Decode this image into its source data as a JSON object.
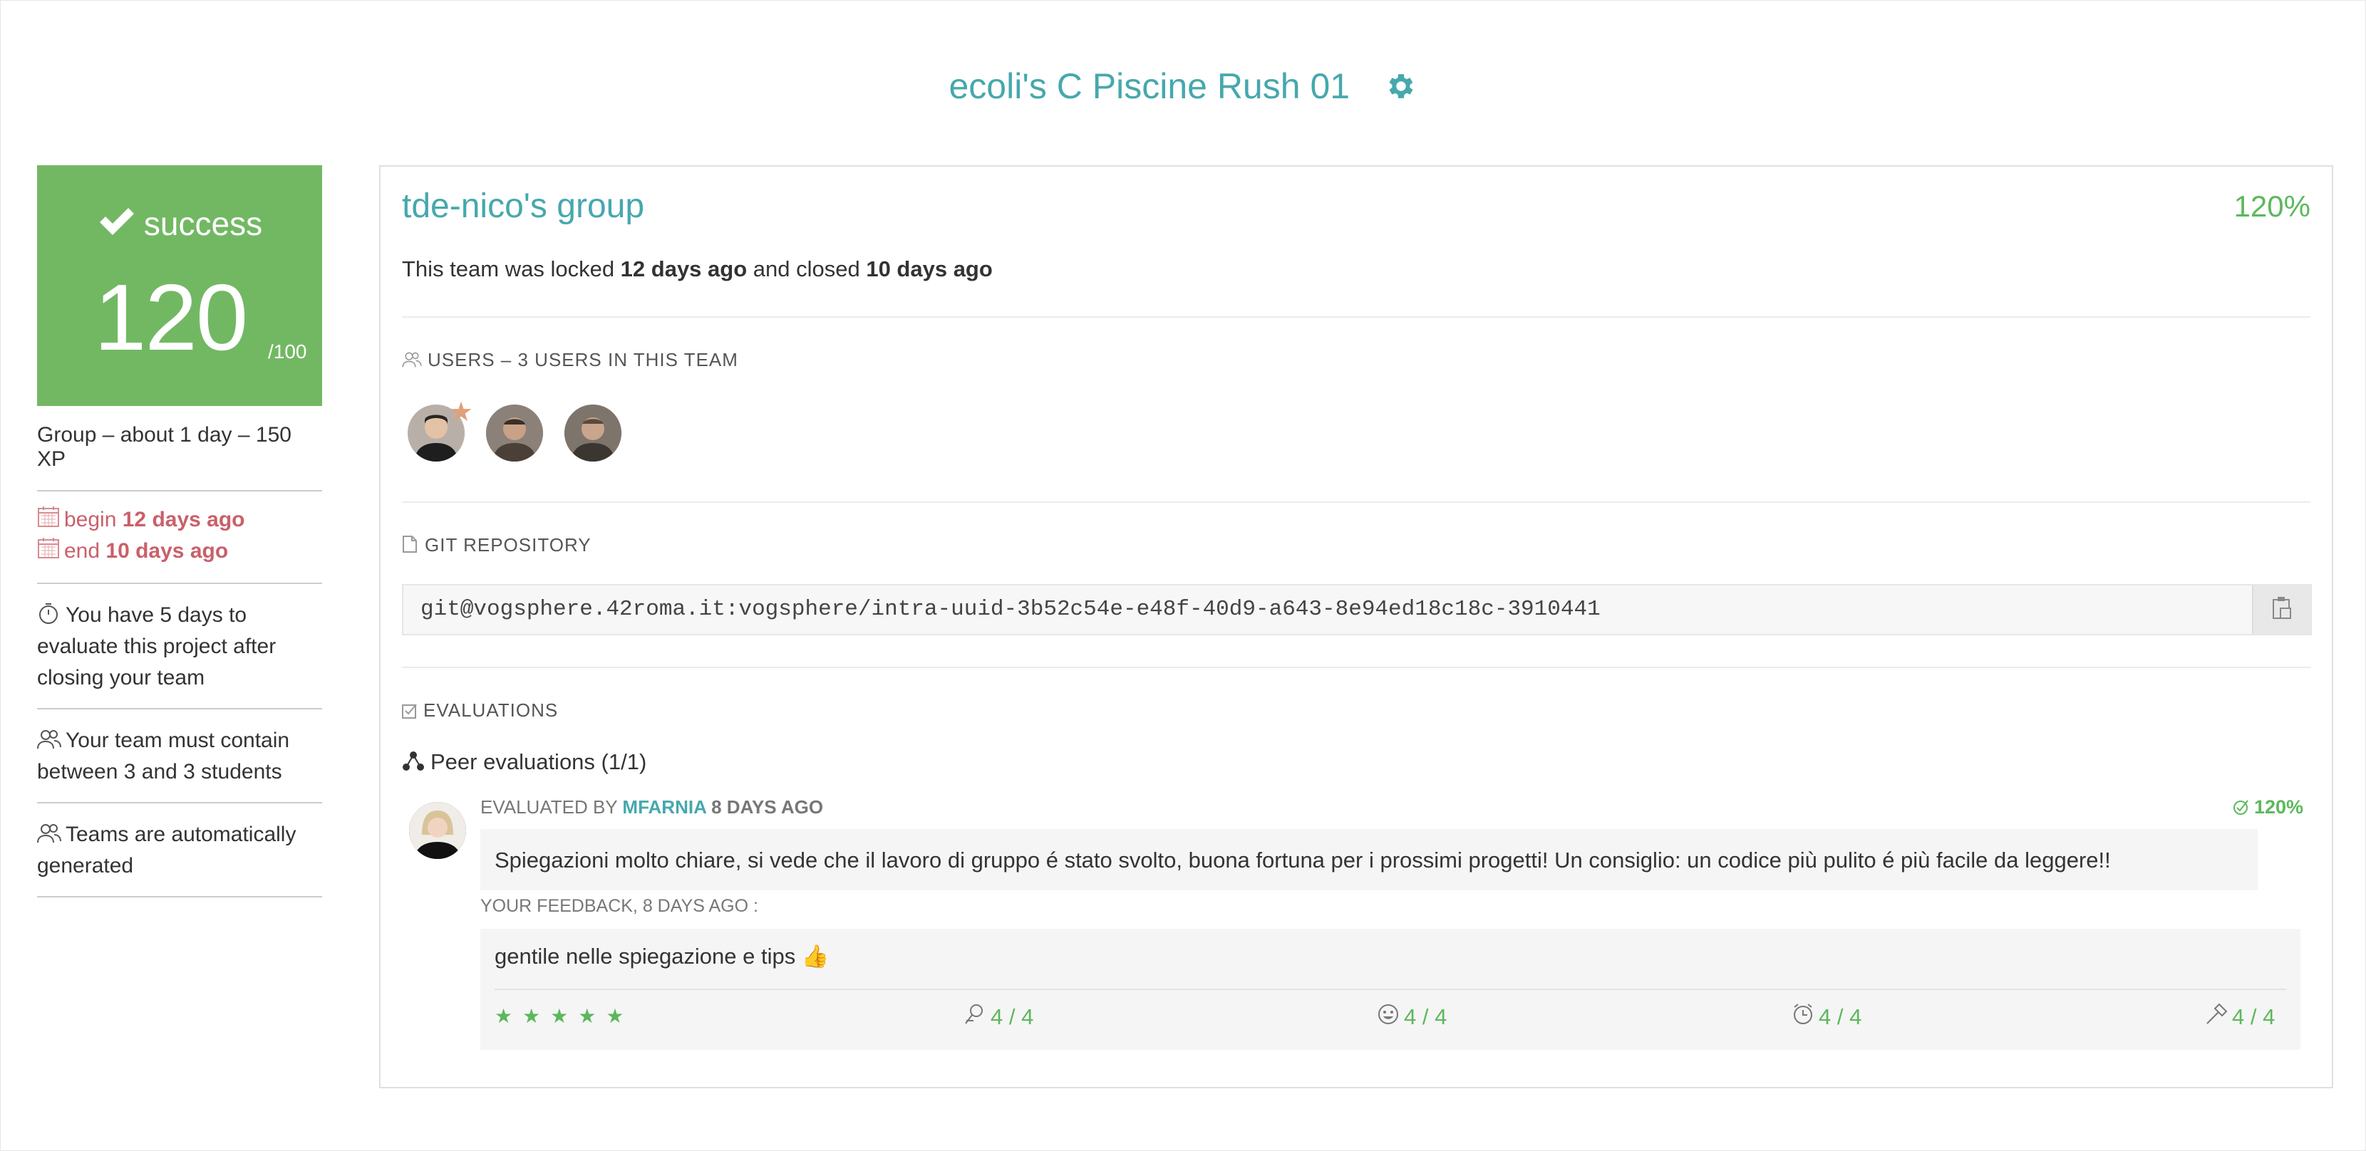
{
  "header": {
    "title": "ecoli's C Piscine Rush 01",
    "settings_icon": "gear-icon"
  },
  "colors": {
    "accent": "#46a8ad",
    "success": "#72b863",
    "success_text": "#5cb85c",
    "date_red": "#c9606a"
  },
  "grade": {
    "status": "success",
    "score": "120",
    "max": "/100"
  },
  "sidebar": {
    "meta": "Group – about 1 day – 150 XP",
    "begin_label": "begin",
    "begin_value": "12 days ago",
    "end_label": "end",
    "end_value": "10 days ago",
    "evaluate_note": "You have 5 days to evaluate this project after closing your team",
    "team_size_note": "Your team must contain between 3 and 3 students",
    "auto_note": "Teams are automatically generated"
  },
  "team": {
    "name": "tde-nico's group",
    "percent": "120%",
    "lock_prefix": "This team was locked ",
    "locked_ago": "12 days ago",
    "lock_middle": " and closed ",
    "closed_ago": "10 days ago"
  },
  "users": {
    "heading": "USERS – 3 USERS IN THIS TEAM",
    "count": 3
  },
  "git": {
    "heading": "GIT REPOSITORY",
    "url": "git@vogsphere.42roma.it:vogsphere/intra-uuid-3b52c54e-e48f-40d9-a643-8e94ed18c18c-3910441"
  },
  "evaluations": {
    "heading": "EVALUATIONS",
    "peer_title": "Peer evaluations (1/1)",
    "evaluated_by_label": "EVALUATED BY ",
    "evaluator": "MFARNIA",
    "evaluated_ago": " 8 DAYS AGO",
    "percent": "120%",
    "comment": "Spiegazioni molto chiare, si vede che il lavoro di gruppo é stato svolto, buona fortuna per i prossimi progetti! Un consiglio: un codice più pulito é più facile da leggere!!",
    "feedback_label": "YOUR FEEDBACK, 8 DAYS AGO :",
    "feedback": "gentile nelle spiegazione e tips 👍",
    "stars": "★★★★★",
    "star_rating": 5,
    "ratings": [
      {
        "icon": "interest-icon",
        "value": "4 / 4"
      },
      {
        "icon": "nice-icon",
        "value": "4 / 4"
      },
      {
        "icon": "punctuality-icon",
        "value": "4 / 4"
      },
      {
        "icon": "rigor-icon",
        "value": "4 / 4"
      }
    ]
  }
}
